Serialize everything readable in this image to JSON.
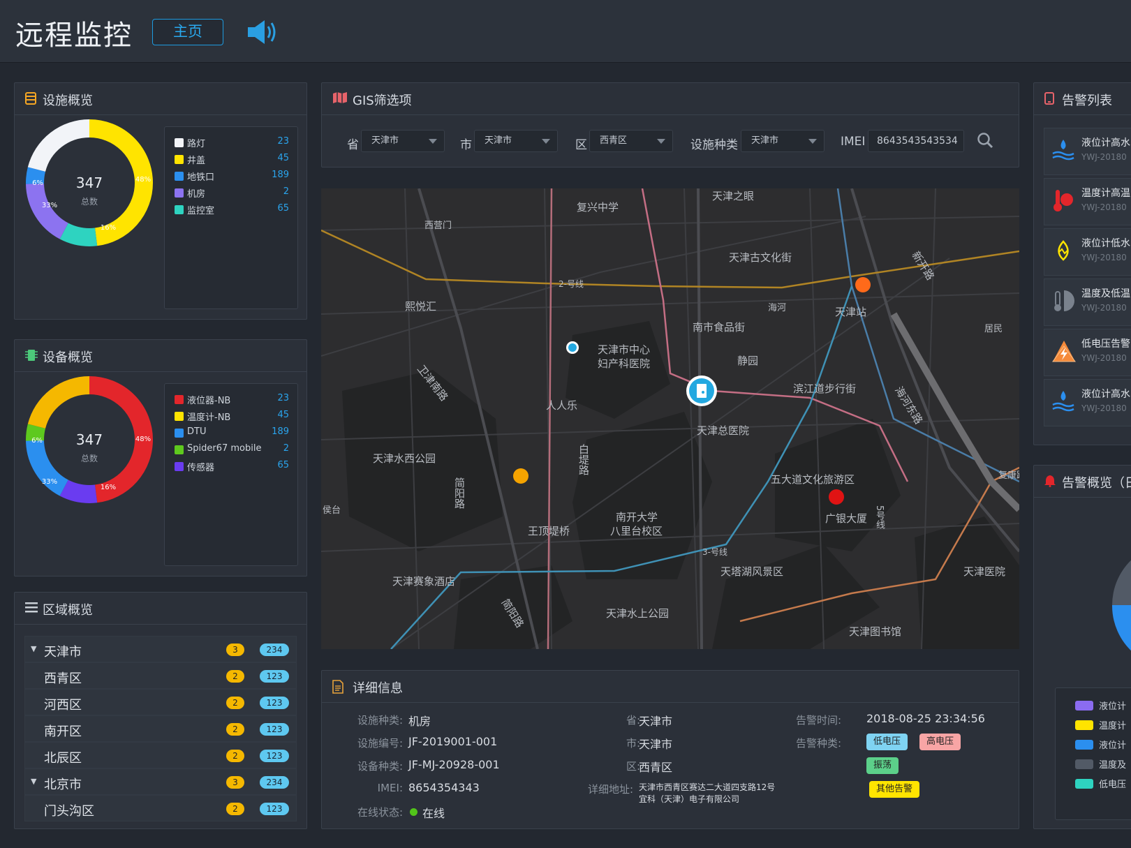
{
  "header": {
    "title": "远程监控",
    "home_label": "主页"
  },
  "facility": {
    "title": "设施概览",
    "total": "347",
    "total_label": "总数",
    "pcts": [
      "48%",
      "16%",
      "33%",
      "6%"
    ],
    "legend": [
      {
        "label": "路灯",
        "value": "23",
        "color": "#f2f4f8"
      },
      {
        "label": "井盖",
        "value": "45",
        "color": "#ffe400"
      },
      {
        "label": "地铁口",
        "value": "189",
        "color": "#2b8fef"
      },
      {
        "label": "机房",
        "value": "2",
        "color": "#8c73f0"
      },
      {
        "label": "监控室",
        "value": "65",
        "color": "#2ed3c0"
      }
    ]
  },
  "device": {
    "title": "设备概览",
    "total": "347",
    "total_label": "总数",
    "pcts": [
      "48%",
      "16%",
      "33%",
      "6%"
    ],
    "legend": [
      {
        "label": "液位器-NB",
        "value": "23",
        "color": "#e3262b"
      },
      {
        "label": "温度计-NB",
        "value": "45",
        "color": "#ffe400"
      },
      {
        "label": "DTU",
        "value": "189",
        "color": "#2b8fef"
      },
      {
        "label": "Spider67 mobile",
        "value": "2",
        "color": "#5ec91e"
      },
      {
        "label": "传感器",
        "value": "65",
        "color": "#6a3cf0"
      }
    ]
  },
  "region": {
    "title": "区域概览",
    "rows": [
      {
        "name": "天津市",
        "a": "3",
        "b": "234",
        "parent": true
      },
      {
        "name": "西青区",
        "a": "2",
        "b": "123",
        "parent": false
      },
      {
        "name": "河西区",
        "a": "2",
        "b": "123",
        "parent": false
      },
      {
        "name": "南开区",
        "a": "2",
        "b": "123",
        "parent": false
      },
      {
        "name": "北辰区",
        "a": "2",
        "b": "123",
        "parent": false
      },
      {
        "name": "北京市",
        "a": "3",
        "b": "234",
        "parent": true
      },
      {
        "name": "门头沟区",
        "a": "2",
        "b": "123",
        "parent": false
      }
    ]
  },
  "gis": {
    "title": "GIS筛选项",
    "province_label": "省",
    "province_value": "天津市",
    "city_label": "市",
    "city_value": "天津市",
    "district_label": "区",
    "district_value": "西青区",
    "type_label": "设施种类",
    "type_value": "天津市",
    "imei_label": "IMEI",
    "imei_value": "8643543543534"
  },
  "map": {
    "labels": [
      "天津之眼",
      "复兴中学",
      "西营门",
      "天津古文化街",
      "2-号线",
      "熙悦汇",
      "海河",
      "天津站",
      "南市食品街",
      "居民",
      "天津市中心",
      "妇产科医院",
      "静园",
      "滨江道步行街",
      "人人乐",
      "天津总医院",
      "天津水西公园",
      "五大道文化旅游区",
      "广银大厦",
      "南开大学",
      "八里台校区",
      "王顶堤桥",
      "侯台",
      "3-号线",
      "天塔湖风景区",
      "天津医院",
      "天津赛象酒店",
      "天津水上公园",
      "天津图书馆",
      "简阳路",
      "白堤路",
      "简阳路",
      "卫津南路",
      "海河东路",
      "新开路",
      "5号线",
      "复康路"
    ]
  },
  "detail": {
    "title": "详细信息",
    "facility_type_k": "设施种类:",
    "facility_type_v": "机房",
    "facility_no_k": "设施编号:",
    "facility_no_v": "JF-2019001-001",
    "device_type_k": "设备种类:",
    "device_type_v": "JF-MJ-20928-001",
    "imei_k": "IMEI:",
    "imei_v": "8654354343",
    "online_k": "在线状态:",
    "online_v": "在线",
    "province_k": "省:",
    "province_v": "天津市",
    "city_k": "市:",
    "city_v": "天津市",
    "district_k": "区:",
    "district_v": "西青区",
    "address_k": "详细地址:",
    "address_v1": "天津市西青区赛达二大道四支路12号",
    "address_v2": "宜科（天津）电子有限公司",
    "alarm_time_k": "告警时间:",
    "alarm_time_v": "2018-08-25 23:34:56",
    "alarm_type_k": "告警种类:",
    "tags": [
      "低电压",
      "高电压",
      "振荡",
      "其他告警"
    ]
  },
  "alarm_list": {
    "title": "告警列表",
    "items": [
      {
        "title": "液位计高水",
        "sub": "YWJ-20180"
      },
      {
        "title": "温度计高温",
        "sub": "YWJ-20180"
      },
      {
        "title": "液位计低水",
        "sub": "YWJ-20180"
      },
      {
        "title": "温度及低温",
        "sub": "YWJ-20180"
      },
      {
        "title": "低电压告警",
        "sub": "YWJ-20180"
      },
      {
        "title": "液位计高水",
        "sub": "YWJ-20180"
      }
    ]
  },
  "alarm_overview": {
    "title": "告警概览（日",
    "legend": [
      {
        "label": "液位计",
        "color": "#8b6cf0"
      },
      {
        "label": "温度计",
        "color": "#ffe400"
      },
      {
        "label": "液位计",
        "color": "#2b8fef"
      },
      {
        "label": "温度及",
        "color": "#525a66"
      },
      {
        "label": "低电压",
        "color": "#2ed3c0"
      }
    ]
  }
}
